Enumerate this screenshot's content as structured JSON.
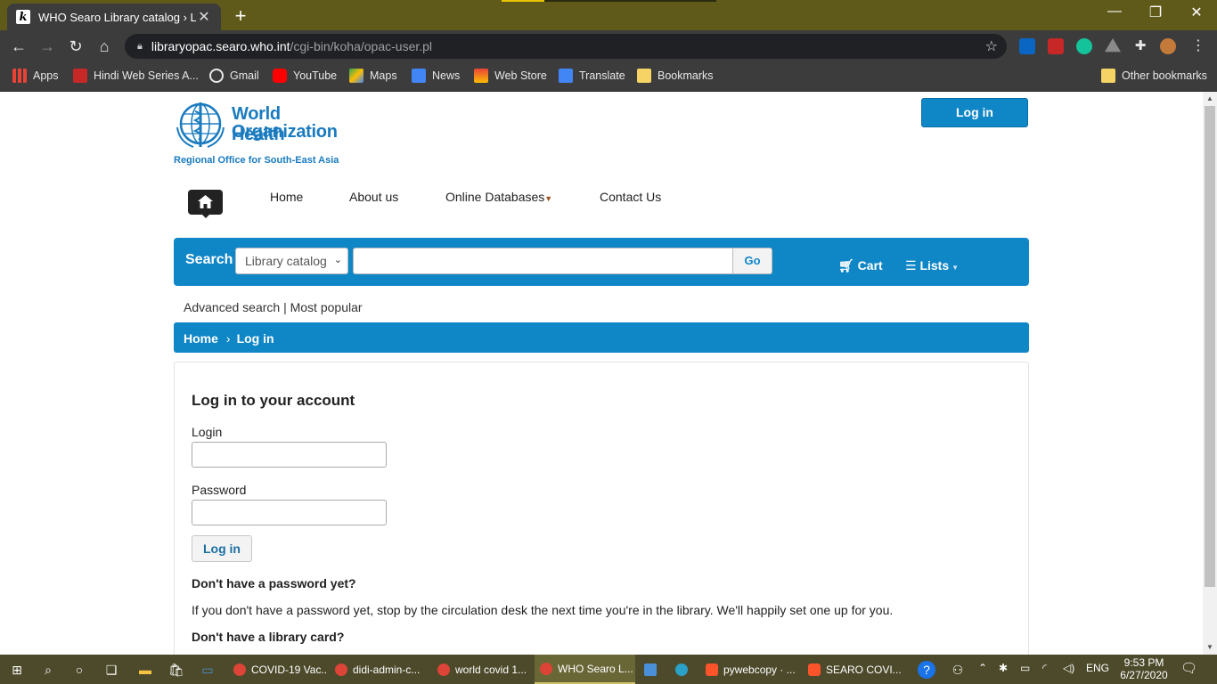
{
  "browser": {
    "tab_title": "WHO Searo Library catalog › Log",
    "tab_favicon": "k",
    "new_tab": "+",
    "url_host": "libraryopac.searo.who.int",
    "url_path": "/cgi-bin/koha/opac-user.pl",
    "bookmarks": [
      {
        "label": "Apps",
        "icon": "apps-grid-icon",
        "color": "#e8e8e8"
      },
      {
        "label": "Hindi Web Series A...",
        "icon": "red-square-icon",
        "color": "#c62828"
      },
      {
        "label": "Gmail",
        "icon": "globe-icon",
        "color": "#e8e8e8"
      },
      {
        "label": "YouTube",
        "icon": "youtube-icon",
        "color": "#ff0000"
      },
      {
        "label": "Maps",
        "icon": "maps-icon",
        "color": "#34a853"
      },
      {
        "label": "News",
        "icon": "news-icon",
        "color": "#4285f4"
      },
      {
        "label": "Web Store",
        "icon": "webstore-icon",
        "color": "#ea4335"
      },
      {
        "label": "Translate",
        "icon": "translate-icon",
        "color": "#4285f4"
      },
      {
        "label": "Bookmarks",
        "icon": "folder-icon",
        "color": "#f6d365"
      }
    ],
    "other_bookmarks": "Other bookmarks"
  },
  "site": {
    "logo_line1": "World Health",
    "logo_line2": "Organization",
    "logo_sub": "Regional Office for South-East Asia",
    "top_login": "Log in",
    "nav": [
      "Home",
      "About us",
      "Online Databases",
      "Contact Us"
    ],
    "search": {
      "label": "Search",
      "scope": "Library catalog",
      "query": "",
      "go": "Go",
      "cart": "Cart",
      "lists": "Lists"
    },
    "advanced": "Advanced search",
    "advanced_sep": "|",
    "popular": "Most popular",
    "breadcrumb": [
      "Home",
      "Log in"
    ],
    "breadcrumb_sep": "›"
  },
  "login_panel": {
    "heading": "Log in to your account",
    "login_label": "Login",
    "login_value": "",
    "password_label": "Password",
    "password_value": "",
    "submit": "Log in",
    "no_password_heading": "Don't have a password yet?",
    "no_password_text": "If you don't have a password yet, stop by the circulation desk the next time you're in the library. We'll happily set one up for you.",
    "no_card_heading": "Don't have a library card?"
  },
  "taskbar": {
    "apps": [
      {
        "label": "COVID-19 Vac...",
        "color": "#db4437",
        "active": false
      },
      {
        "label": "didi-admin-c...",
        "color": "#db4437",
        "active": false
      },
      {
        "label": "world covid 1...",
        "color": "#db4437",
        "active": false
      },
      {
        "label": "WHO Searo L...",
        "color": "#db4437",
        "active": true
      },
      {
        "label": "",
        "color": "#4a90d9",
        "active": false
      },
      {
        "label": "",
        "color": "#2aa1c9",
        "active": false
      },
      {
        "label": "pywebcopy · ...",
        "color": "#fb542b",
        "active": false
      },
      {
        "label": "SEARO COVI...",
        "color": "#fb542b",
        "active": false
      }
    ],
    "lang": "ENG",
    "time": "9:53 PM",
    "date": "6/27/2020"
  }
}
